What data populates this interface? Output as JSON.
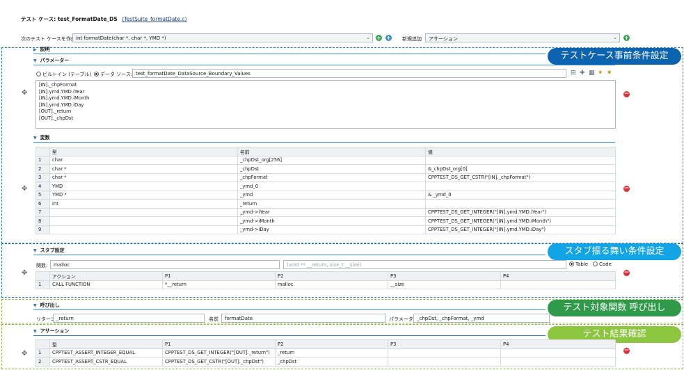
{
  "header": {
    "title": "テスト ケース: test_FormatDate_DS",
    "suite_link": "(TestSuite_formatDate.c)"
  },
  "toolbar": {
    "next_label": "次のテスト ケースを作成",
    "function_value": "int formatDate(char *, char *, YMD *)",
    "new_label": "新規追加",
    "new_value": "アサーション"
  },
  "sections": {
    "description": "説明",
    "parameters": "パラメーター",
    "variables": "変数",
    "stubs": "スタブ設定",
    "call": "呼び出し",
    "assertions": "アサーション"
  },
  "parameters": {
    "builtin_label": "ビルトイン (テーブル)",
    "datasource_label": "データ ソース:",
    "datasource_value": "test_formatDate_DataSource_Boundary_Values",
    "items": [
      "[IN]._chpFormat",
      "[IN].ymd.YMD.iYear",
      "[IN].ymd.YMD.iMonth",
      "[IN].ymd.YMD.iDay",
      "[OUT]._return",
      "[OUT]._chpDst"
    ]
  },
  "variables": {
    "headers": [
      "型",
      "名前",
      "値"
    ],
    "rows": [
      {
        "n": "1",
        "type": "char",
        "name": "_chpDst_org[256]",
        "value": ""
      },
      {
        "n": "2",
        "type": "char *",
        "name": "_chpDst",
        "value": "&_chpDst_org[0]"
      },
      {
        "n": "3",
        "type": "char *",
        "name": "_chpFormat",
        "value": "CPPTEST_DS_GET_CSTR(\"[IN]._chpFormat\")"
      },
      {
        "n": "4",
        "type": "YMD",
        "name": "_ymd_0",
        "value": ""
      },
      {
        "n": "5",
        "type": "YMD *",
        "name": "_ymd",
        "value": "& _ymd_0"
      },
      {
        "n": "6",
        "type": "int",
        "name": "_return",
        "value": ""
      },
      {
        "n": "7",
        "type": "",
        "name": "_ymd->iYear",
        "value": "CPPTEST_DS_GET_INTEGER(\"[IN].ymd.YMD.iYear\")"
      },
      {
        "n": "8",
        "type": "",
        "name": "_ymd->iMonth",
        "value": "CPPTEST_DS_GET_INTEGER(\"[IN].ymd.YMD.iMonth\")"
      },
      {
        "n": "9",
        "type": "",
        "name": "_ymd->iDay",
        "value": "CPPTEST_DS_GET_INTEGER(\"[IN].ymd.YMD.iDay\")"
      }
    ]
  },
  "stubs": {
    "function_label": "関数:",
    "function_value": "malloc",
    "signature_placeholder": "(void ** __return, size_t __size)",
    "table_label": "Table",
    "code_label": "Code",
    "headers": [
      "アクション",
      "P1",
      "P2",
      "P3",
      "P4"
    ],
    "rows": [
      {
        "n": "1",
        "action": "CALL FUNCTION",
        "p1": "*__return",
        "p2": "malloc",
        "p3": "__size",
        "p4": ""
      }
    ]
  },
  "call": {
    "return_label": "リターン",
    "return_value": "_return",
    "name_label": "名前",
    "name_value": "formatDate",
    "params_label": "パラメーター",
    "params_value": "_chpDst, _chpFormat, _ymd"
  },
  "assertions": {
    "headers": [
      "型",
      "P1",
      "P2",
      "P3",
      "P4"
    ],
    "rows": [
      {
        "n": "1",
        "type": "CPPTEST_ASSERT_INTEGER_EQUAL",
        "p1": "CPPTEST_DS_GET_INTEGER(\"[OUT]._return\")",
        "p2": "_return",
        "p3": "",
        "p4": ""
      },
      {
        "n": "2",
        "type": "CPPTEST_ASSERT_CSTR_EQUAL",
        "p1": "CPPTEST_DS_GET_CSTR(\"[OUT]._chpDst\")",
        "p2": "_chpDst",
        "p3": "",
        "p4": ""
      }
    ]
  },
  "banners": {
    "precondition": "テストケース事前条件設定",
    "stub": "スタブ振る舞い条件設定",
    "call": "テスト対象関数 呼び出し",
    "result": "テスト結果確認"
  },
  "colors": {
    "banner_blue_dark": "#0c63b0",
    "banner_blue_light": "#12a4e4",
    "banner_green_dark": "#2f9a4a",
    "banner_green_light": "#8cc63f"
  }
}
